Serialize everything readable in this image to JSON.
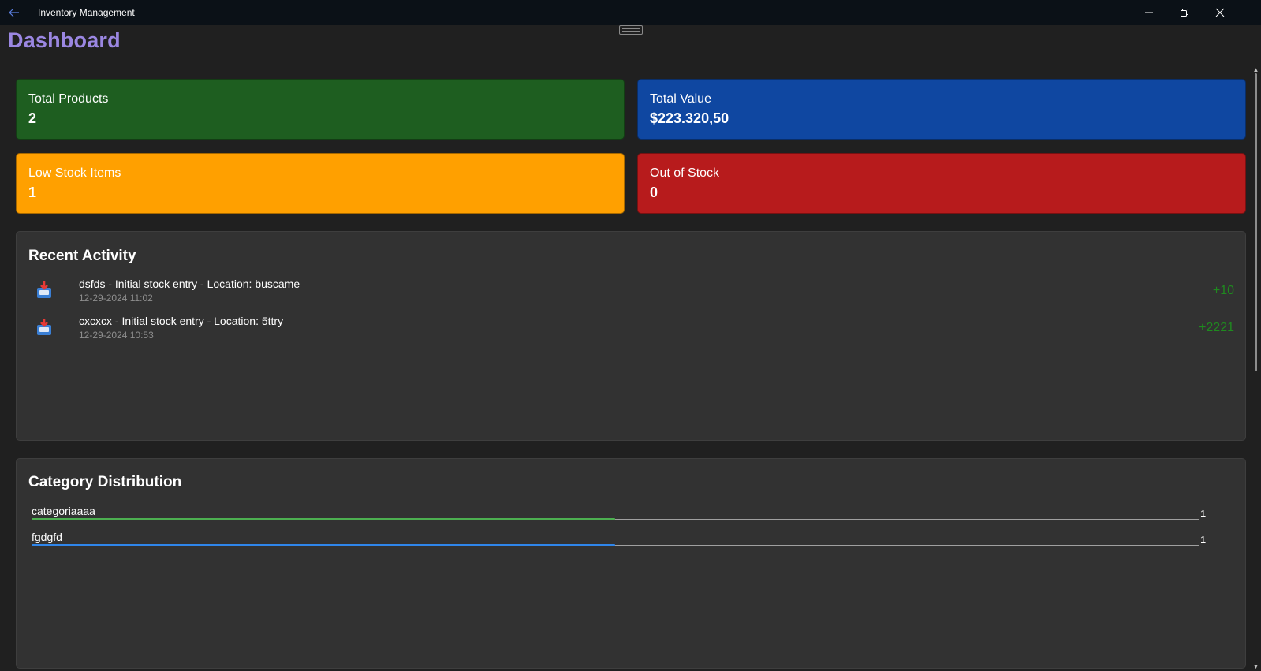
{
  "window": {
    "title": "Inventory Management",
    "back_icon": "arrow-left-icon",
    "minimize_icon": "minimize-icon",
    "restore_icon": "restore-icon",
    "close_icon": "close-icon"
  },
  "page": {
    "title": "Dashboard",
    "title_color": "#9b87e2"
  },
  "stats": [
    {
      "label": "Total Products",
      "value": "2",
      "color": "#1e5e20"
    },
    {
      "label": "Total Value",
      "value": "$223.320,50",
      "color": "#0f47a1"
    },
    {
      "label": "Low Stock Items",
      "value": "1",
      "color": "#ffa000"
    },
    {
      "label": "Out of Stock",
      "value": "0",
      "color": "#b71b1c"
    }
  ],
  "recent_activity": {
    "title": "Recent Activity",
    "items": [
      {
        "icon": "inbox-tray-icon",
        "text": "dsfds - Initial stock entry - Location: buscame",
        "time": "12-29-2024 11:02",
        "qty": "+10"
      },
      {
        "icon": "inbox-tray-icon",
        "text": "cxcxcx - Initial stock entry - Location: 5ttry",
        "time": "12-29-2024 10:53",
        "qty": "+2221"
      }
    ]
  },
  "category_distribution": {
    "title": "Category Distribution",
    "items": [
      {
        "name": "categoriaaaa",
        "count": "1",
        "fraction": 0.5,
        "color": "#4caf50"
      },
      {
        "name": "fgdgfd",
        "count": "1",
        "fraction": 0.5,
        "color": "#2f86eb"
      }
    ]
  }
}
